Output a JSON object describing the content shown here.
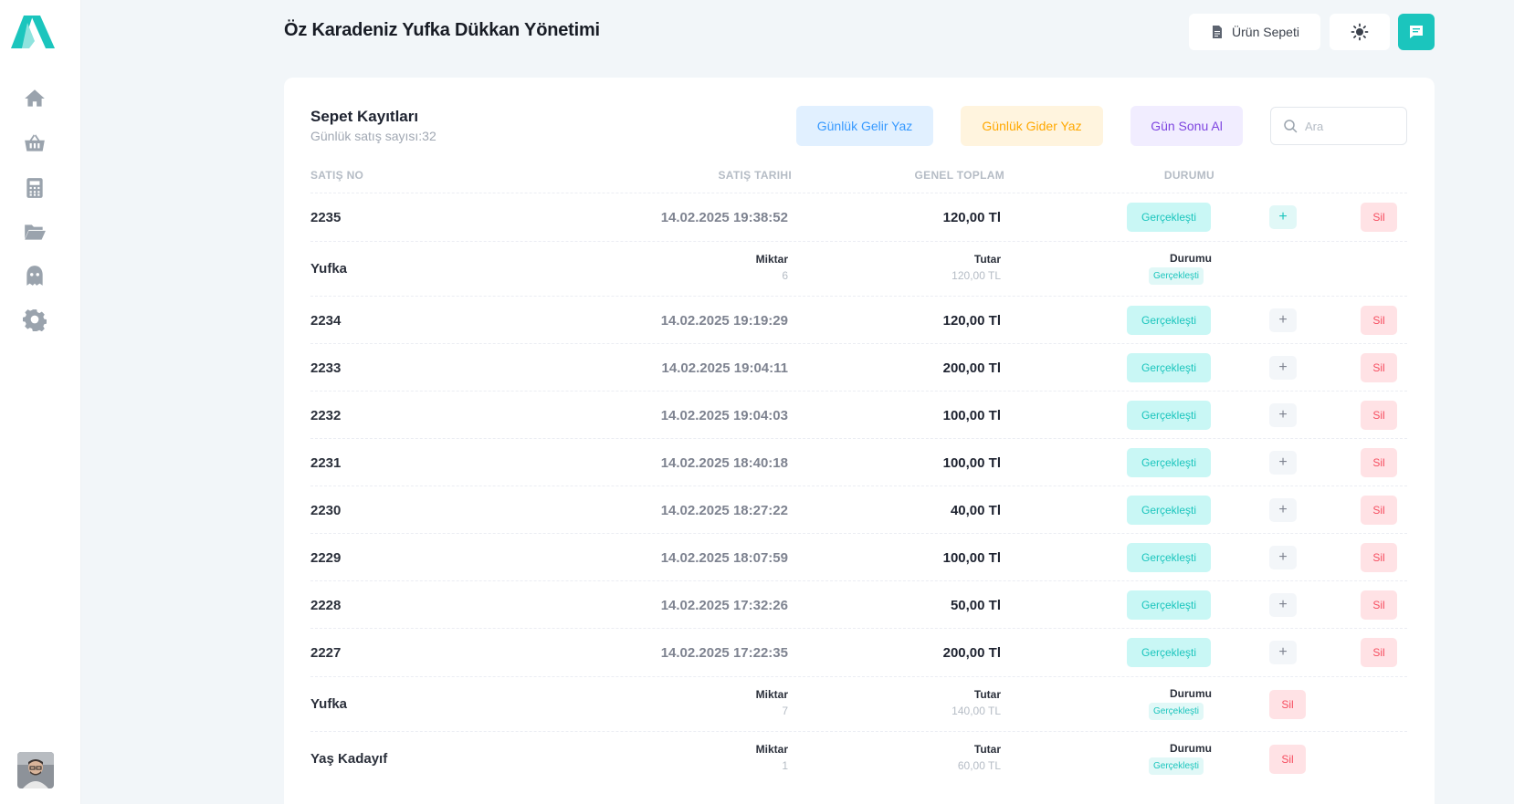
{
  "header": {
    "title": "Öz Karadeniz Yufka Dükkan Yönetimi",
    "cart_label": "Ürün Sepeti"
  },
  "sidebar": {
    "items": [
      {
        "icon": "home-icon"
      },
      {
        "icon": "basket-icon"
      },
      {
        "icon": "calculator-icon"
      },
      {
        "icon": "folder-icon"
      },
      {
        "icon": "ghost-icon"
      },
      {
        "icon": "gear-icon"
      }
    ]
  },
  "card": {
    "title": "Sepet Kayıtları",
    "subtitle": "Günlük satış sayısı:32",
    "actions": {
      "gelir": "Günlük Gelir Yaz",
      "gider": "Günlük Gider Yaz",
      "gunsonu": "Gün Sonu Al"
    },
    "search_placeholder": "Ara"
  },
  "columns": {
    "no": "SATIŞ NO",
    "date": "SATIŞ TARIHI",
    "total": "GENEL TOPLAM",
    "status": "DURUMU"
  },
  "rows": [
    {
      "no": "2235",
      "date": "14.02.2025 19:38:52",
      "total": "120,00 Tl",
      "status": "Gerçekleşti",
      "plus": "+",
      "del": "Sil"
    },
    {
      "no": "2234",
      "date": "14.02.2025 19:19:29",
      "total": "120,00 Tl",
      "status": "Gerçekleşti",
      "plus": "+",
      "del": "Sil"
    },
    {
      "no": "2233",
      "date": "14.02.2025 19:04:11",
      "total": "200,00 Tl",
      "status": "Gerçekleşti",
      "plus": "+",
      "del": "Sil"
    },
    {
      "no": "2232",
      "date": "14.02.2025 19:04:03",
      "total": "100,00 Tl",
      "status": "Gerçekleşti",
      "plus": "+",
      "del": "Sil"
    },
    {
      "no": "2231",
      "date": "14.02.2025 18:40:18",
      "total": "100,00 Tl",
      "status": "Gerçekleşti",
      "plus": "+",
      "del": "Sil"
    },
    {
      "no": "2230",
      "date": "14.02.2025 18:27:22",
      "total": "40,00 Tl",
      "status": "Gerçekleşti",
      "plus": "+",
      "del": "Sil"
    },
    {
      "no": "2229",
      "date": "14.02.2025 18:07:59",
      "total": "100,00 Tl",
      "status": "Gerçekleşti",
      "plus": "+",
      "del": "Sil"
    },
    {
      "no": "2228",
      "date": "14.02.2025 17:32:26",
      "total": "50,00 Tl",
      "status": "Gerçekleşti",
      "plus": "+",
      "del": "Sil"
    },
    {
      "no": "2227",
      "date": "14.02.2025 17:22:35",
      "total": "200,00 Tl",
      "status": "Gerçekleşti",
      "plus": "+",
      "del": "Sil"
    }
  ],
  "details": [
    {
      "name": "Yufka",
      "qty_label": "Miktar",
      "qty": "6",
      "amount_label": "Tutar",
      "amount": "120,00 TL",
      "status_label": "Durumu",
      "status": "Gerçekleşti"
    },
    {
      "name": "Yufka",
      "qty_label": "Miktar",
      "qty": "7",
      "amount_label": "Tutar",
      "amount": "140,00 TL",
      "status_label": "Durumu",
      "status": "Gerçekleşti",
      "del": "Sil"
    },
    {
      "name": "Yaş Kadayıf",
      "qty_label": "Miktar",
      "qty": "1",
      "amount_label": "Tutar",
      "amount": "60,00 TL",
      "status_label": "Durumu",
      "status": "Gerçekleşti",
      "del": "Sil"
    }
  ],
  "colors": {
    "brand": "#1bc5bd",
    "info": "#3699ff",
    "warning": "#ffa800",
    "purple": "#7e45e0",
    "danger": "#f64e60"
  }
}
